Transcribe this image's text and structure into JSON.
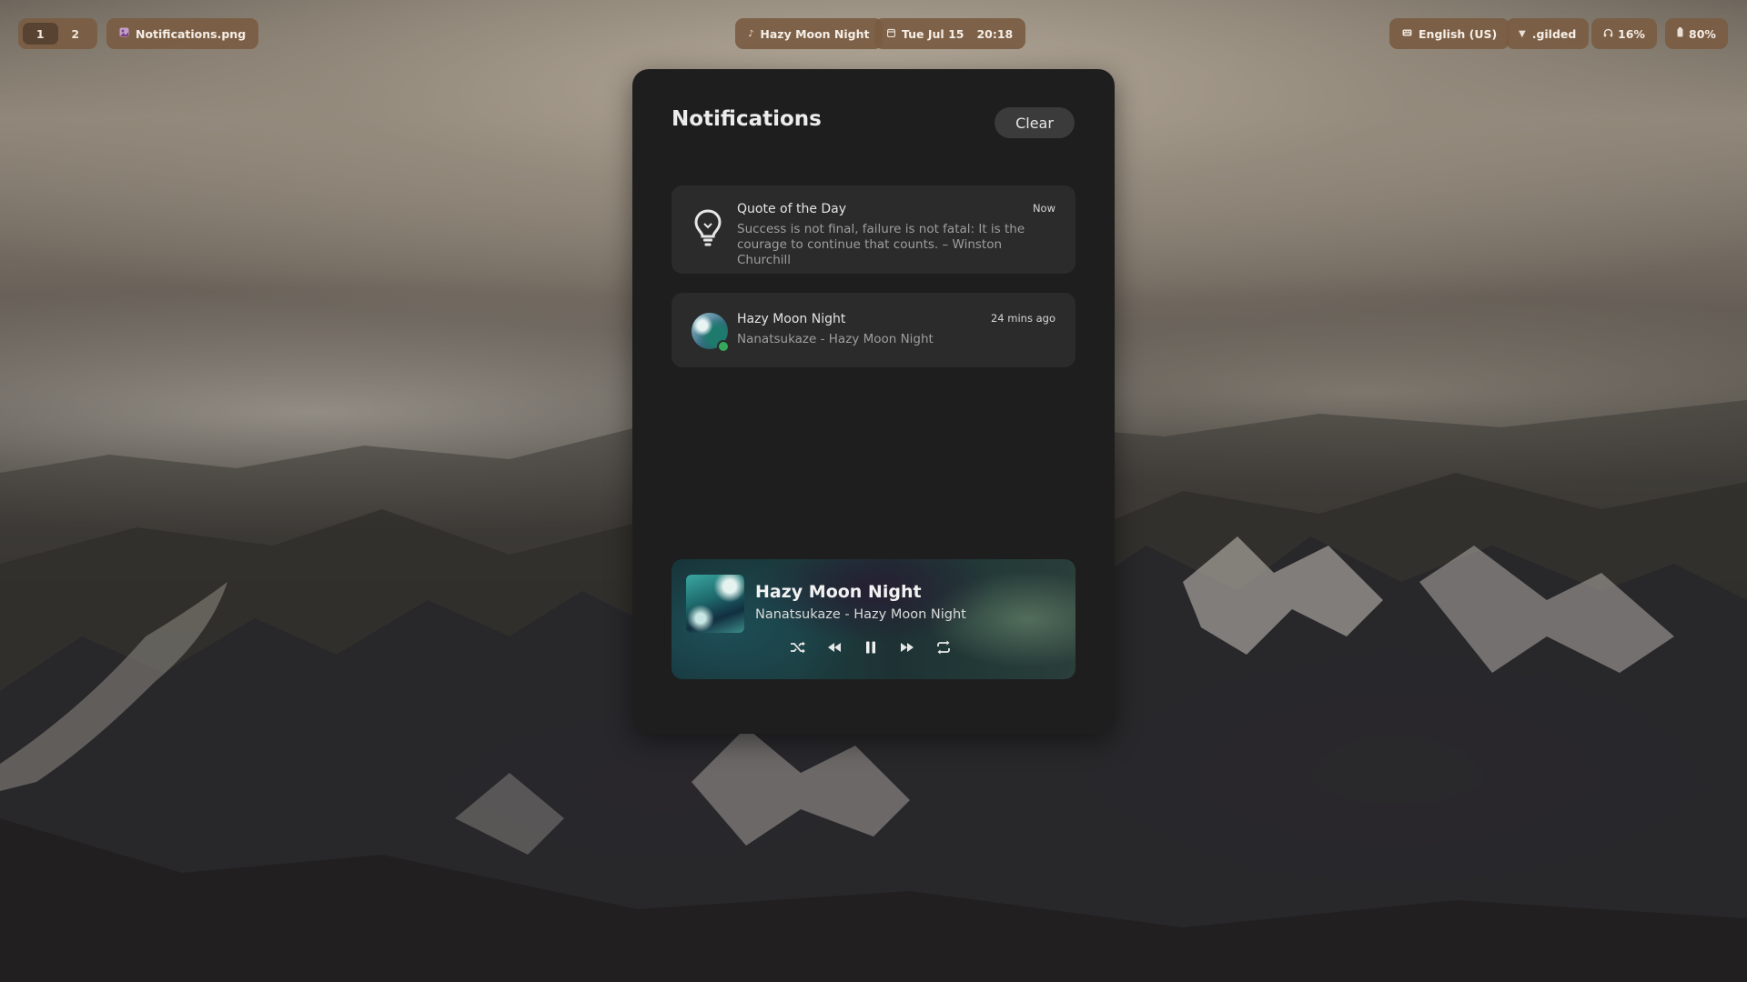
{
  "topbar": {
    "workspaces": [
      "1",
      "2"
    ],
    "active_window": "Notifications.png",
    "media": "Hazy Moon Night",
    "date": "Tue Jul 15",
    "time": "20:18",
    "keyboard_layout": "English (US)",
    "network": ".gilded",
    "volume": "16%",
    "battery": "80%"
  },
  "panel": {
    "title": "Notifications",
    "clear_label": "Clear",
    "notifications": [
      {
        "icon": "lightbulb-icon",
        "title": "Quote of the Day",
        "time": "Now",
        "body": "Success is not final, failure is not fatal: It is the courage to continue that counts. – Winston Churchill"
      },
      {
        "icon": "album-avatar",
        "title": "Hazy Moon Night",
        "time": "24 mins ago",
        "body": "Nanatsukaze - Hazy Moon Night"
      }
    ]
  },
  "player": {
    "title": "Hazy Moon Night",
    "subtitle": "Nanatsukaze - Hazy Moon Night",
    "controls": [
      "shuffle-icon",
      "previous-icon",
      "pause-icon",
      "next-icon",
      "repeat-icon"
    ]
  },
  "colors": {
    "pill_bg": "#7a5c42",
    "panel_bg": "#1e1e1e",
    "card_bg": "#2b2b2b"
  }
}
